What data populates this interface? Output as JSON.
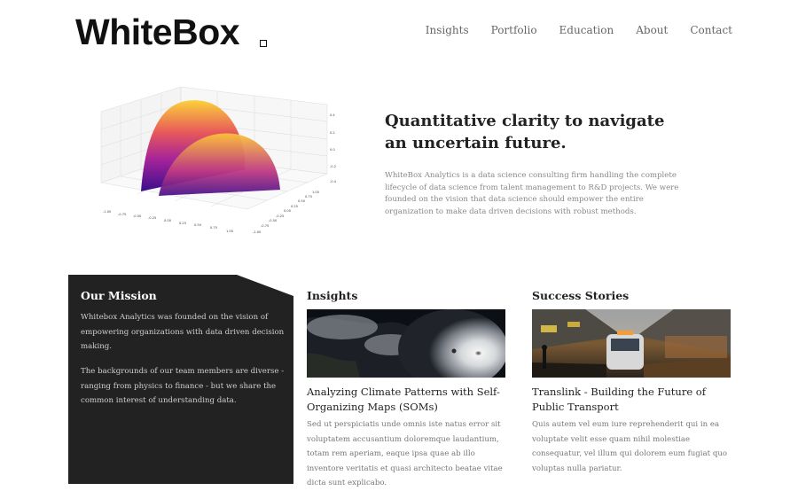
{
  "header": {
    "logo_text": "WhiteBox",
    "nav": [
      "Insights",
      "Portfolio",
      "Education",
      "About",
      "Contact"
    ]
  },
  "hero": {
    "title": "Quantitative clarity to navigate an uncertain future.",
    "text": "WhiteBox Analytics is a data science consulting firm handling the complete lifecycle of data science from talent management to R&D projects. We were founded on the vision that data science should empower the entire organization to make data driven decisions with robust methods.",
    "plot_x_ticks": [
      "-1.00",
      "-0.75",
      "-0.50",
      "-0.25",
      "0.00",
      "0.25",
      "0.50",
      "0.75",
      "1.00"
    ],
    "plot_y_ticks": [
      "1.00",
      "0.75",
      "0.50",
      "0.25",
      "0.00",
      "-0.25",
      "-0.50",
      "-0.75",
      "-1.00"
    ],
    "plot_z_ticks": [
      "0.4",
      "0.2",
      "0.0",
      "-0.2",
      "-0.4"
    ]
  },
  "mission": {
    "title": "Our Mission",
    "p1": "Whitebox Analytics was founded on the vision of empowering organizations with data driven decision making.",
    "p2": "The backgrounds of our team members are diverse - ranging from physics to finance - but we share the common interest of understanding data."
  },
  "insights": {
    "heading": "Insights",
    "card_title": "Analyzing Climate Patterns with Self-Organizing Maps (SOMs)",
    "card_text": "Sed ut perspiciatis unde omnis iste natus error sit voluptatem accusantium doloremque laudantium, totam rem aperiam, eaque ipsa quae ab illo inventore veritatis et quasi architecto beatae vitae dicta sunt explicabo."
  },
  "success": {
    "heading": "Success Stories",
    "card_title": "Translink - Building the Future of Public Transport",
    "card_text": "Quis autem vel eum iure reprehenderit qui in ea voluptate velit esse quam nihil molestiae consequatur, vel illum qui dolorem eum fugiat quo voluptas nulla pariatur."
  }
}
